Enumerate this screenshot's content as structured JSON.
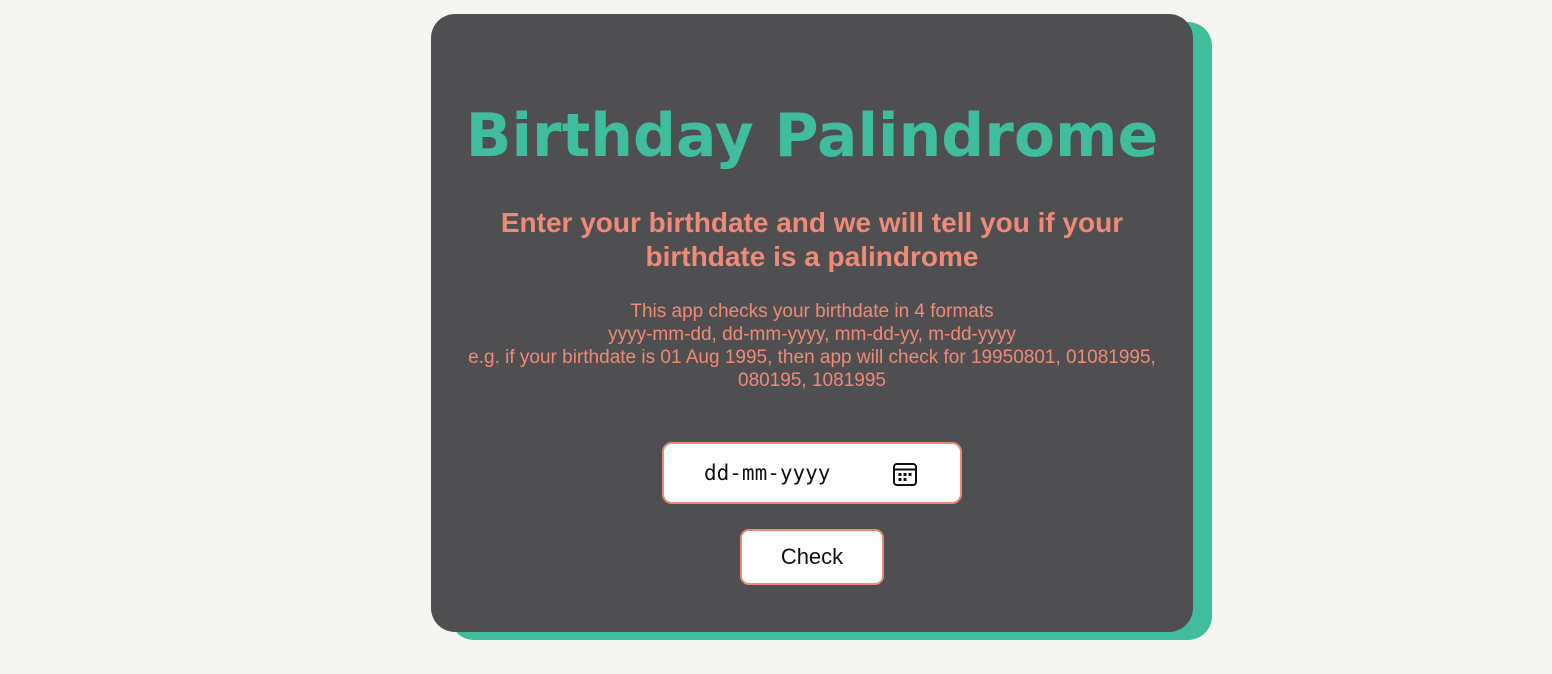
{
  "header": {
    "title": "Birthday Palindrome",
    "subtitle": "Enter your birthdate and we will tell you if your birthdate is a palindrome"
  },
  "info": {
    "line1": "This app checks your birthdate in 4 formats",
    "line2": "yyyy-mm-dd, dd-mm-yyyy, mm-dd-yy, m-dd-yyyy",
    "line3": "e.g. if your birthdate is 01 Aug 1995, then app will check for 19950801, 01081995, 080195, 1081995"
  },
  "form": {
    "date_placeholder": "dd-mm-yyyy",
    "calendar_icon": "calendar-icon",
    "check_label": "Check"
  },
  "colors": {
    "page_background": "#f5f5f2",
    "card_background": "#4f4f51",
    "accent_green": "#3fbd9c",
    "accent_salmon": "#f08a78"
  }
}
